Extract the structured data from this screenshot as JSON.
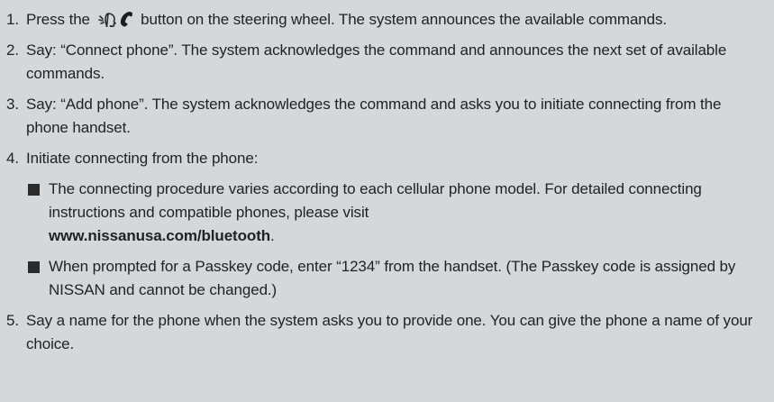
{
  "steps": [
    {
      "num": "1.",
      "pre": "Press the",
      "icons": [
        "voice-talk-icon",
        "phone-handset-icon"
      ],
      "post": "button on the steering wheel. The system announces the available commands."
    },
    {
      "num": "2.",
      "text": "Say: “Connect phone”. The system acknowledges the command and announces the next set of available commands."
    },
    {
      "num": "3.",
      "text": "Say: “Add phone”. The system acknowledges the command and asks you to initiate connecting from the phone handset."
    },
    {
      "num": "4.",
      "text": "Initiate connecting from the phone:",
      "bullets": [
        {
          "text": "The connecting procedure varies according to each cellular phone model. For detailed connecting instructions and compatible phones, please visit",
          "url": "www.nissanusa.com/bluetooth",
          "after": "."
        },
        {
          "text": "When prompted for a Passkey code, enter “1234” from the handset. (The Passkey code is assigned by NISSAN and cannot be changed.)"
        }
      ]
    },
    {
      "num": "5.",
      "text": "Say a name for the phone when the system asks you to provide one. You can give the phone a name of your choice."
    }
  ]
}
